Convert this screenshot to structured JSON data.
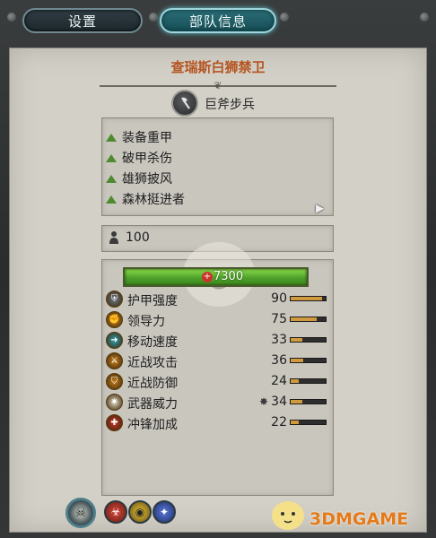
{
  "tabs": [
    {
      "label": "设置",
      "active": false
    },
    {
      "label": "部队信息",
      "active": true
    }
  ],
  "unit": {
    "name": "查瑞斯白狮禁卫",
    "type_label": "巨斧步兵",
    "type_icon": "axe-icon"
  },
  "traits": [
    {
      "label": "装备重甲"
    },
    {
      "label": "破甲杀伤"
    },
    {
      "label": "雄狮披风"
    },
    {
      "label": "森林挺进者"
    }
  ],
  "men": {
    "count": "100",
    "icon": "soldier-icon"
  },
  "health": {
    "value": "7300",
    "fill_fraction": 1.0,
    "color": "#5ab02e"
  },
  "stats": [
    {
      "label": "护甲强度",
      "value": "90",
      "fill": 0.9,
      "icon": "armor-icon",
      "color": "#6d7a86"
    },
    {
      "label": "领导力",
      "value": "75",
      "fill": 0.75,
      "icon": "leadership-icon",
      "color": "#d88a1e"
    },
    {
      "label": "移动速度",
      "value": "33",
      "fill": 0.33,
      "icon": "speed-icon",
      "color": "#2f9fb0"
    },
    {
      "label": "近战攻击",
      "value": "36",
      "fill": 0.36,
      "icon": "melee-attack-icon",
      "color": "#c7801e"
    },
    {
      "label": "近战防御",
      "value": "24",
      "fill": 0.24,
      "icon": "melee-defence-icon",
      "color": "#c7801e"
    },
    {
      "label": "武器威力",
      "value": "34",
      "fill": 0.34,
      "icon": "weapon-strength-icon",
      "color": "#e0d8c0"
    },
    {
      "label": "冲锋加成",
      "value": "22",
      "fill": 0.22,
      "icon": "charge-bonus-icon",
      "color": "#c9342a"
    }
  ],
  "weapon_bonus_icon": "armour-piercing-icon",
  "abilities": [
    {
      "icon": "unit-ability-main-icon"
    },
    {
      "icon": "ability-red-icon"
    },
    {
      "icon": "ability-yellow-icon"
    },
    {
      "icon": "ability-blue-icon"
    }
  ],
  "watermark": {
    "text": "3DMGAME"
  },
  "colors": {
    "title": "#b5541f",
    "parchment": "#d3d0c8",
    "active_tab": "#2c6f78",
    "trait_arrow": "#4e8a2e",
    "stat_bar_fill": "#d19a3e"
  }
}
